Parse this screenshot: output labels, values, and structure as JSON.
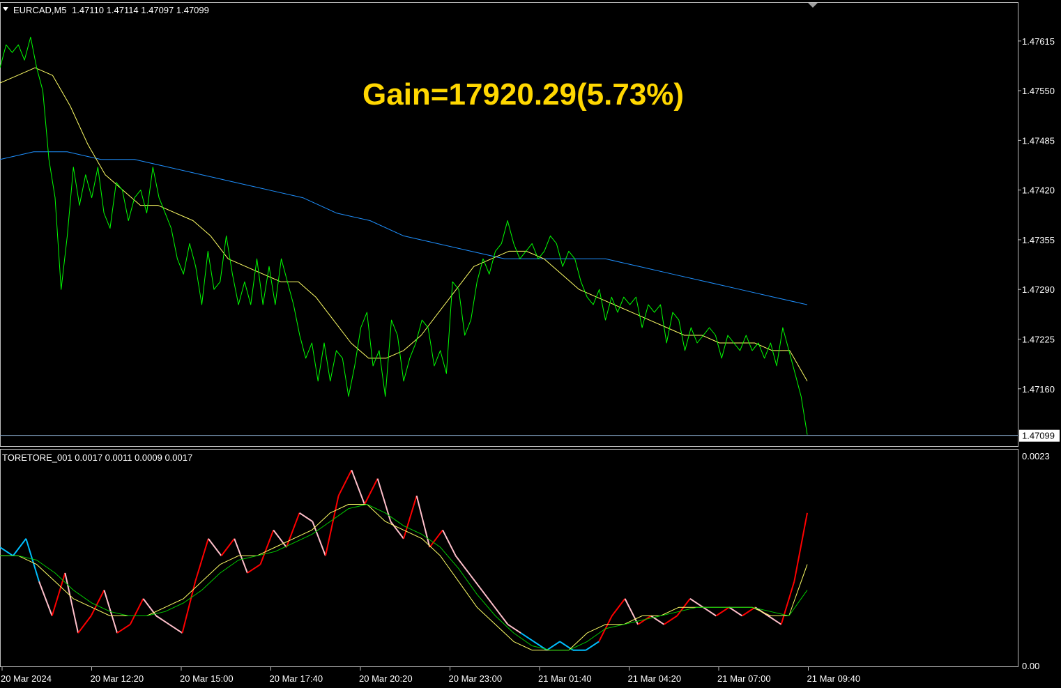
{
  "header": {
    "symbol": "EURCAD,M5",
    "ohlc": "1.47110 1.47114 1.47097 1.47099"
  },
  "annotation": {
    "text": "Gain=17920.29(5.73%)",
    "color": "#ffd700"
  },
  "indicator": {
    "label": "TORETORE_001 0.0017 0.0011 0.0009 0.0017"
  },
  "colors": {
    "price": "#00ff00",
    "fast_ma": "#ffff66",
    "slow_ma": "#1e90ff",
    "grid": "#c0c0c0",
    "bid_line": "#87a9c9",
    "osc_up": "#ff0000",
    "osc_down": "#ffc0cb",
    "osc_blue": "#00bfff",
    "osc_signal1": "#ffff66",
    "osc_signal2": "#00cc00"
  },
  "chart_data": [
    {
      "type": "line",
      "title": "",
      "y_ticks": [
        "1.47615",
        "1.47550",
        "1.47485",
        "1.47420",
        "1.47355",
        "1.47290",
        "1.47225",
        "1.47160"
      ],
      "current_price_label": "1.47099",
      "ylim": [
        1.47085,
        1.47665
      ],
      "x_ticks": [
        "20 Mar 2024",
        "20 Mar 12:20",
        "20 Mar 15:00",
        "20 Mar 17:40",
        "20 Mar 20:20",
        "20 Mar 23:00",
        "21 Mar 01:40",
        "21 Mar 04:20",
        "21 Mar 07:00",
        "21 Mar 09:40"
      ],
      "series": [
        {
          "values": [
            1.4758,
            1.4761,
            1.476,
            1.4761,
            1.4759,
            1.4762,
            1.4758,
            1.4755,
            1.4746,
            1.4741,
            1.4729,
            1.4736,
            1.4745,
            1.474,
            1.4744,
            1.4741,
            1.4745,
            1.4739,
            1.4737,
            1.4743,
            1.4742,
            1.4738,
            1.4741,
            1.4742,
            1.4739,
            1.4745,
            1.4741,
            1.4739,
            1.4737,
            1.4733,
            1.4731,
            1.4735,
            1.4732,
            1.4727,
            1.4734,
            1.4729,
            1.473,
            1.4736,
            1.4731,
            1.4727,
            1.473,
            1.4727,
            1.4733,
            1.4727,
            1.4732,
            1.4727,
            1.4733,
            1.473,
            1.4727,
            1.4723,
            1.472,
            1.4722,
            1.4717,
            1.4722,
            1.4717,
            1.4721,
            1.472,
            1.4715,
            1.4719,
            1.4724,
            1.4726,
            1.4719,
            1.4721,
            1.4715,
            1.4725,
            1.4723,
            1.4717,
            1.472,
            1.4722,
            1.4725,
            1.4724,
            1.4719,
            1.4721,
            1.4718,
            1.473,
            1.4729,
            1.4723,
            1.4725,
            1.473,
            1.4733,
            1.4731,
            1.4734,
            1.4735,
            1.4738,
            1.4735,
            1.4733,
            1.4734,
            1.4735,
            1.4733,
            1.4734,
            1.4736,
            1.4735,
            1.4732,
            1.4734,
            1.4733,
            1.473,
            1.4728,
            1.4727,
            1.4729,
            1.4725,
            1.4728,
            1.4726,
            1.4728,
            1.4727,
            1.4728,
            1.4724,
            1.4727,
            1.4726,
            1.4727,
            1.4722,
            1.4726,
            1.4725,
            1.4721,
            1.4724,
            1.4722,
            1.4723,
            1.4724,
            1.4723,
            1.472,
            1.4723,
            1.4722,
            1.4721,
            1.4723,
            1.4721,
            1.4722,
            1.472,
            1.4722,
            1.4719,
            1.4724,
            1.4721,
            1.4718,
            1.4715,
            1.471
          ],
          "color_key": "price"
        },
        {
          "values": [
            1.4756,
            1.4757,
            1.4758,
            1.4757,
            1.4753,
            1.4748,
            1.4744,
            1.4742,
            1.474,
            1.474,
            1.4739,
            1.4738,
            1.4736,
            1.4733,
            1.4732,
            1.4731,
            1.473,
            1.473,
            1.4728,
            1.4725,
            1.4722,
            1.472,
            1.472,
            1.4721,
            1.4723,
            1.4726,
            1.4729,
            1.4732,
            1.4733,
            1.4734,
            1.4734,
            1.4733,
            1.4731,
            1.4729,
            1.4728,
            1.4727,
            1.4726,
            1.4725,
            1.4724,
            1.4723,
            1.4723,
            1.4722,
            1.4722,
            1.4722,
            1.4721,
            1.4721,
            1.4717
          ],
          "color_key": "fast_ma"
        },
        {
          "values": [
            1.4746,
            1.4747,
            1.4747,
            1.4746,
            1.4746,
            1.4745,
            1.4744,
            1.4743,
            1.4742,
            1.4741,
            1.4739,
            1.4738,
            1.4736,
            1.4735,
            1.4734,
            1.4733,
            1.4733,
            1.4733,
            1.4733,
            1.4732,
            1.4731,
            1.473,
            1.4729,
            1.4728,
            1.4727
          ],
          "color_key": "slow_ma"
        }
      ]
    },
    {
      "type": "line",
      "title": "",
      "y_ticks": [
        "0.0023",
        "0.00"
      ],
      "ylim": [
        0,
        0.0023
      ],
      "series": [
        {
          "values": [
            0.0013,
            0.0012,
            0.0014,
            0.0009,
            0.0005,
            0.001,
            0.0003,
            0.0005,
            0.0008,
            0.0003,
            0.0004,
            0.0007,
            0.0005,
            0.0004,
            0.0003,
            0.0009,
            0.0014,
            0.0012,
            0.0014,
            0.001,
            0.0011,
            0.0015,
            0.0013,
            0.0017,
            0.0016,
            0.0012,
            0.0019,
            0.0022,
            0.0018,
            0.0021,
            0.0016,
            0.0014,
            0.0019,
            0.0013,
            0.0015,
            0.0012,
            0.001,
            0.0008,
            0.0006,
            0.0004,
            0.0003,
            0.0002,
            0.0001,
            0.0002,
            0.0001,
            0.0001,
            0.0002,
            0.0005,
            0.0007,
            0.0004,
            0.0005,
            0.0004,
            0.0005,
            0.0007,
            0.0006,
            0.0005,
            0.0006,
            0.0005,
            0.0006,
            0.0005,
            0.0004,
            0.0009,
            0.0017
          ],
          "color_key": "osc_up"
        },
        {
          "values": [
            0.0012,
            0.0012,
            0.0011,
            0.0009,
            0.0007,
            0.0006,
            0.0005,
            0.0005,
            0.0005,
            0.0006,
            0.0007,
            0.0009,
            0.0011,
            0.0012,
            0.0012,
            0.0013,
            0.0014,
            0.0015,
            0.0017,
            0.0018,
            0.0018,
            0.0016,
            0.0015,
            0.0014,
            0.0012,
            0.0009,
            0.0006,
            0.0004,
            0.0002,
            0.0001,
            0.0001,
            0.0001,
            0.0003,
            0.0004,
            0.0004,
            0.0005,
            0.0005,
            0.0006,
            0.0006,
            0.0006,
            0.0006,
            0.0006,
            0.0005,
            0.0005,
            0.0011
          ],
          "color_key": "osc_signal1"
        }
      ]
    }
  ]
}
